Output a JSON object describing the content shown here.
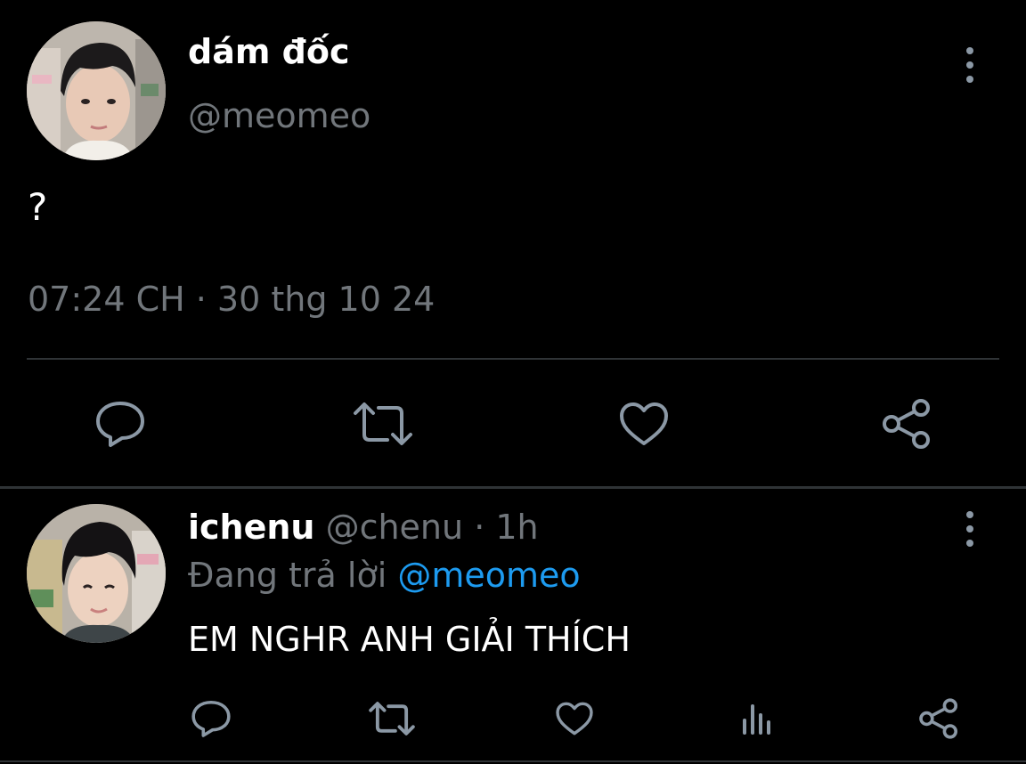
{
  "main_tweet": {
    "display_name": "dám đốc",
    "handle": "@meomeo",
    "text": "?",
    "timestamp": "07:24 CH · 30 thg 10 24",
    "icons": [
      "reply-icon",
      "retweet-icon",
      "like-icon",
      "share-icon",
      "more-icon"
    ]
  },
  "reply_tweet": {
    "display_name": "ichenu",
    "handle": "@chenu",
    "separator": " · ",
    "time_ago": "1h",
    "replying_prefix": "Đang trả lời ",
    "replying_to": "@meomeo",
    "text": "EM NGHR ANH GIẢI THÍCH",
    "icons": [
      "reply-icon",
      "retweet-icon",
      "like-icon",
      "views-icon",
      "share-icon",
      "more-icon"
    ]
  },
  "colors": {
    "background": "#000000",
    "primary_text": "#ffffff",
    "secondary_text": "#71767b",
    "accent": "#1d9bf0",
    "icon": "#8b98a5",
    "divider": "#2f3336"
  }
}
